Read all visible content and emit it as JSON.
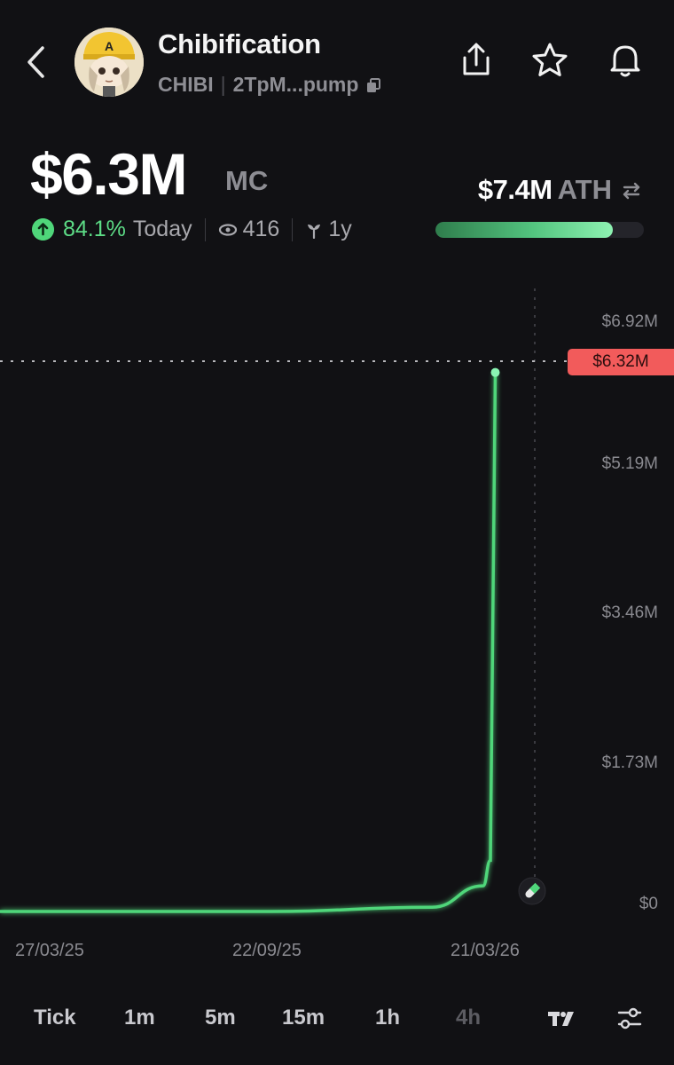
{
  "header": {
    "title": "Chibification",
    "ticker": "CHIBI",
    "address": "2TpM...pump",
    "icons": [
      "back-icon",
      "share-icon",
      "star-icon",
      "bell-icon",
      "copy-icon"
    ]
  },
  "market": {
    "mc_value": "$6.3M",
    "mc_unit": "MC",
    "change_pct": "84.1%",
    "change_period": "Today",
    "holders": "416",
    "age": "1y",
    "ath_value": "$7.4M",
    "ath_label": "ATH",
    "ath_progress": 0.85,
    "accent": "#4fd67a"
  },
  "chart_data": {
    "type": "line",
    "y_ticks": [
      "$6.92M",
      "$5.19M",
      "$3.46M",
      "$1.73M",
      "$0"
    ],
    "current_price_label": "$6.32M",
    "x_ticks": [
      "27/03/25",
      "22/09/25",
      "21/03/26"
    ],
    "series": [
      {
        "values": [
          {
            "x": "27/03/25",
            "y": 0
          },
          {
            "x": "22/09/25",
            "y": 0
          },
          {
            "x": "01/02/26",
            "y": 0.05
          },
          {
            "x": "15/03/26",
            "y": 0.3
          },
          {
            "x": "21/03/26",
            "y": 0.6
          },
          {
            "x": "25/03/26",
            "y": 6.32
          }
        ]
      }
    ],
    "ylim": [
      0,
      6.92
    ],
    "line_color": "#4fd67a",
    "price_tag_color": "#f25b5b"
  },
  "timeframes": {
    "items": [
      "Tick",
      "1m",
      "5m",
      "15m",
      "1h",
      "4h"
    ],
    "selected": "4h"
  }
}
